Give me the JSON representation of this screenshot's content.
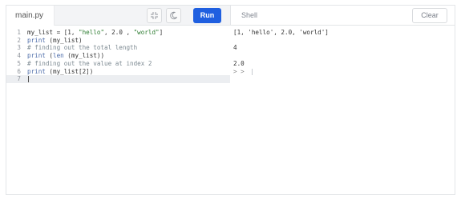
{
  "editor": {
    "file_tab": "main.py",
    "run_label": "Run",
    "icons": {
      "expand": "expand-icon",
      "theme": "moon-icon"
    },
    "lines": [
      {
        "n": "1",
        "tokens": [
          {
            "t": "my_list = [1, ",
            "c": "pl"
          },
          {
            "t": "\"hello\"",
            "c": "str"
          },
          {
            "t": ", 2.0 , ",
            "c": "pl"
          },
          {
            "t": "\"world\"",
            "c": "str"
          },
          {
            "t": "]",
            "c": "pl"
          }
        ]
      },
      {
        "n": "2",
        "tokens": [
          {
            "t": "print",
            "c": "fn"
          },
          {
            "t": " (my_list)",
            "c": "pl"
          }
        ]
      },
      {
        "n": "3",
        "tokens": [
          {
            "t": "# finding out the total length",
            "c": "cm"
          }
        ]
      },
      {
        "n": "4",
        "tokens": [
          {
            "t": "print",
            "c": "fn"
          },
          {
            "t": " (",
            "c": "pl"
          },
          {
            "t": "len",
            "c": "fn"
          },
          {
            "t": " (my_list))",
            "c": "pl"
          }
        ]
      },
      {
        "n": "5",
        "tokens": [
          {
            "t": "# finding out the value at index 2",
            "c": "cm"
          }
        ]
      },
      {
        "n": "6",
        "tokens": [
          {
            "t": "print",
            "c": "fn"
          },
          {
            "t": " (my_list[2])",
            "c": "pl"
          }
        ]
      },
      {
        "n": "7",
        "tokens": []
      }
    ],
    "active_line": 7
  },
  "shell": {
    "title": "Shell",
    "clear_label": "Clear",
    "output": [
      {
        "row": 1,
        "text": "[1, 'hello', 2.0, 'world']"
      },
      {
        "row": 3,
        "text": "4"
      },
      {
        "row": 5,
        "text": "2.0"
      }
    ],
    "prompt": "> >",
    "prompt_row": 6
  },
  "colors": {
    "run_button": "#1f5fe0",
    "string": "#2e7d32",
    "function": "#4a6aa8",
    "comment": "#7d8a92"
  }
}
